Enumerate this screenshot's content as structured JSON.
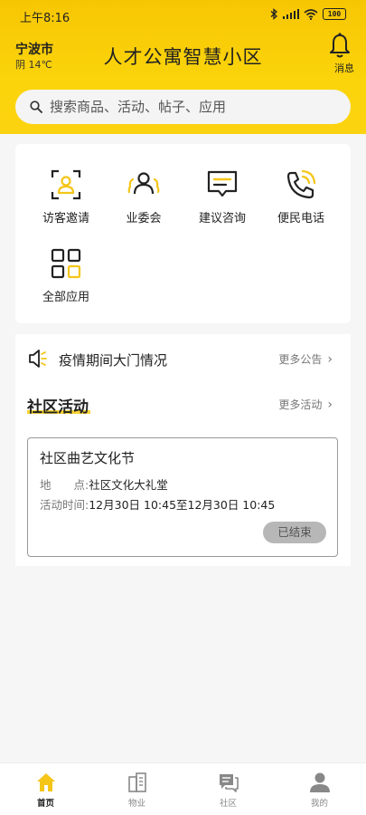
{
  "status_bar": {
    "time": "上午8:16",
    "battery": "100"
  },
  "header": {
    "city": "宁波市",
    "weather": "阴 14℃",
    "title": "人才公寓智慧小区",
    "message_label": "消息"
  },
  "search": {
    "placeholder": "搜索商品、活动、帖子、应用"
  },
  "apps": [
    {
      "label": "访客邀请",
      "icon": "visitor-icon"
    },
    {
      "label": "业委会",
      "icon": "committee-icon"
    },
    {
      "label": "建议咨询",
      "icon": "suggestion-icon"
    },
    {
      "label": "便民电话",
      "icon": "phone-icon"
    },
    {
      "label": "全部应用",
      "icon": "all-apps-icon"
    }
  ],
  "notice": {
    "text": "疫情期间大门情况",
    "more": "更多公告"
  },
  "activities": {
    "title": "社区活动",
    "more": "更多活动",
    "items": [
      {
        "name": "社区曲艺文化节",
        "place_label": "地　　点:",
        "place": "社区文化大礼堂",
        "time_label": "活动时间:",
        "time": "12月30日 10:45至12月30日 10:45",
        "status": "已结束"
      }
    ]
  },
  "tabs": [
    {
      "label": "首页",
      "active": true
    },
    {
      "label": "物业",
      "active": false
    },
    {
      "label": "社区",
      "active": false
    },
    {
      "label": "我的",
      "active": false
    }
  ],
  "colors": {
    "brand": "#f9cd0a",
    "accent": "#f5c518",
    "icon_dark": "#222222"
  }
}
